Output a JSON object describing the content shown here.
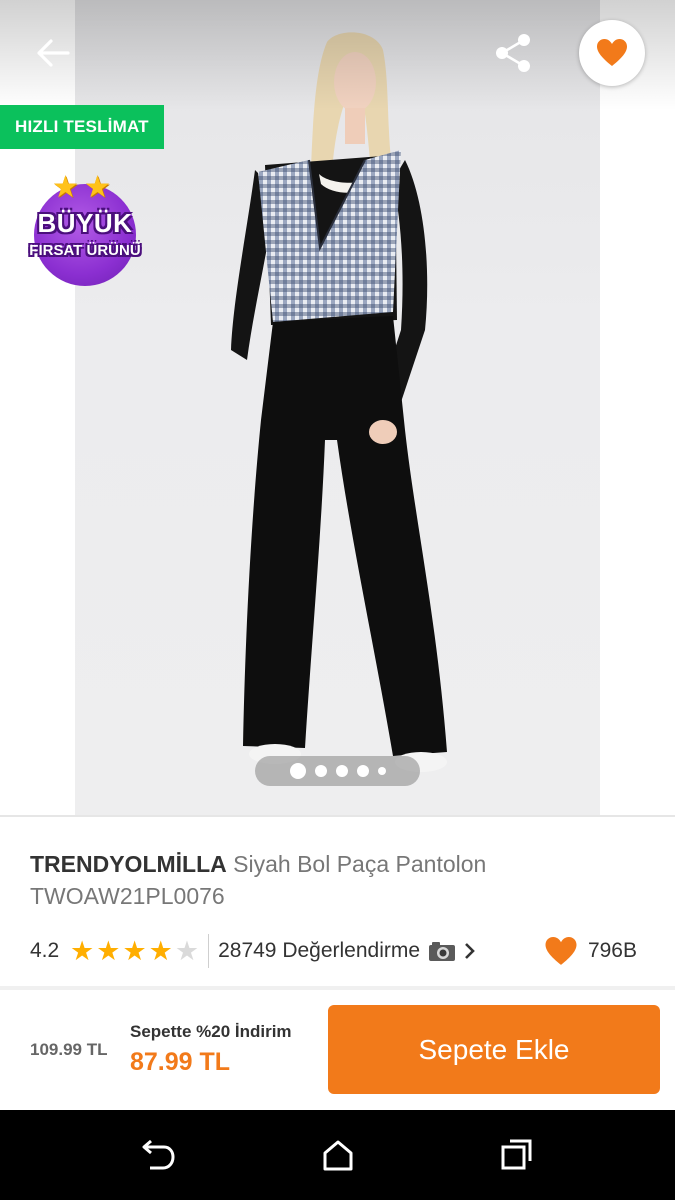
{
  "gallery": {
    "fast_delivery_badge": "HIZLI TESLİMAT",
    "deal_badge": {
      "line1": "BÜYÜK",
      "line2": "FIRSAT ÜRÜNÜ"
    },
    "photo_alt": "",
    "dots_count": 5,
    "active_dot": 1
  },
  "header": {
    "back_icon": "arrow-left-icon",
    "share_icon": "share-icon",
    "favorite_icon": "heart-icon"
  },
  "product": {
    "brand": "TRENDYOLMİLLA",
    "name": "Siyah Bol Paça Pantolon",
    "sku": "TWOAW21PL0076",
    "rating": "4.2",
    "rating_value": 4.2,
    "stars_filled": 4,
    "stars_total": 5,
    "reviews_text": "28749 Değerlendirme",
    "favorites_count": "796B"
  },
  "price_bar": {
    "old_price": "109.99 TL",
    "discount_text": "Sepette %20 İndirim",
    "new_price": "87.99 TL",
    "add_to_cart": "Sepete Ekle"
  },
  "colors": {
    "accent": "#f27a1a",
    "fast_badge": "#0bc15c",
    "deal_purple": "#8b2fd1",
    "star": "#ffae00"
  }
}
